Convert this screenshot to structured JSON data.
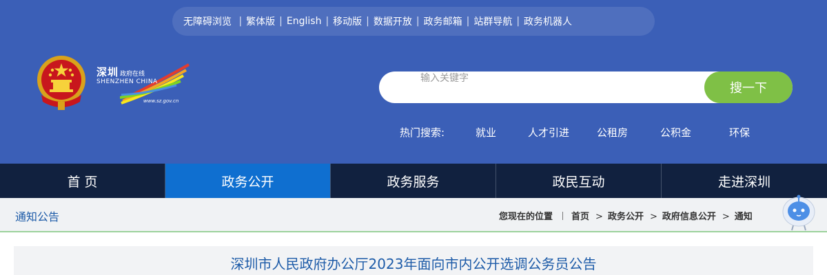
{
  "top_links": [
    "无障碍浏览",
    "繁体版",
    "English",
    "移动版",
    "数据开放",
    "政务邮箱",
    "站群导航",
    "政务机器人"
  ],
  "logo": {
    "name_cn": "深圳",
    "tagline": "政府在线",
    "name_en": "SHENZHEN  CHINA",
    "url": "www.sz.gov.cn"
  },
  "search": {
    "placeholder": "输入关键字",
    "button_label": "搜一下"
  },
  "hot_search": {
    "label": "热门搜索:",
    "items": [
      "就业",
      "人才引进",
      "公租房",
      "公积金",
      "环保"
    ]
  },
  "nav": {
    "items": [
      "首 页",
      "政务公开",
      "政务服务",
      "政民互动",
      "走进深圳"
    ],
    "active_index": 1
  },
  "breadcrumb": {
    "section_title": "通知公告",
    "location_label": "您现在的位置",
    "items": [
      "首页",
      "政务公开",
      "政府信息公开",
      "通知"
    ]
  },
  "article": {
    "title": "深圳市人民政府办公厅2023年面向市内公开选调公务员公告"
  },
  "colors": {
    "header_bg": "#3b5fb7",
    "nav_bg": "#11213f",
    "nav_active": "#0f6fd0",
    "search_button": "#7fc046",
    "link_blue": "#1d5ba8"
  }
}
